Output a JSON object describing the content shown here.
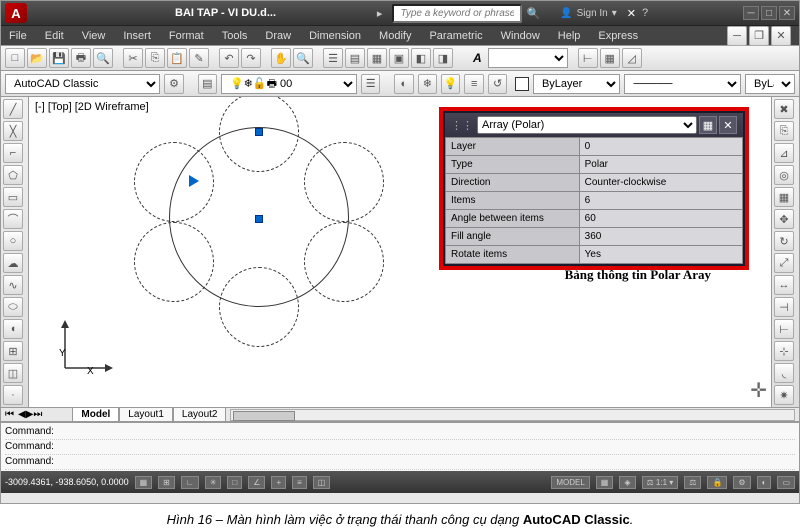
{
  "title": "BAI TAP - VI DU.d...",
  "search_placeholder": "Type a keyword or phrase",
  "signin": "Sign In",
  "menus": [
    "File",
    "Edit",
    "View",
    "Insert",
    "Format",
    "Tools",
    "Draw",
    "Dimension",
    "Modify",
    "Parametric",
    "Window",
    "Help",
    "Express"
  ],
  "workspace": "AutoCAD Classic",
  "layer_value": "0",
  "bylayer": "ByLayer",
  "bylayer2": "ByLa",
  "viewport": "[-] [Top] [2D Wireframe]",
  "ucs": {
    "x": "X",
    "y": "Y"
  },
  "panel": {
    "title": "Array (Polar)",
    "rows": [
      [
        "Layer",
        "0"
      ],
      [
        "Type",
        "Polar"
      ],
      [
        "Direction",
        "Counter-clockwise"
      ],
      [
        "Items",
        "6"
      ],
      [
        "Angle between items",
        "60"
      ],
      [
        "Fill angle",
        "360"
      ],
      [
        "Rotate items",
        "Yes"
      ]
    ]
  },
  "annotation": "Bảng thông tin Polar Aray",
  "tabs": [
    "Model",
    "Layout1",
    "Layout2"
  ],
  "command": {
    "line1": "Command:",
    "line2": "Command:",
    "line3": "Command:"
  },
  "status": {
    "coords": "-3009.4361, -938.6050, 0.0000",
    "model": "MODEL",
    "scale": "1:1"
  },
  "caption_prefix": "Hình 16 – Màn hình làm việc ở trạng thái thanh công cụ dạng ",
  "caption_bold": "AutoCAD Classic",
  "caption_suffix": "."
}
